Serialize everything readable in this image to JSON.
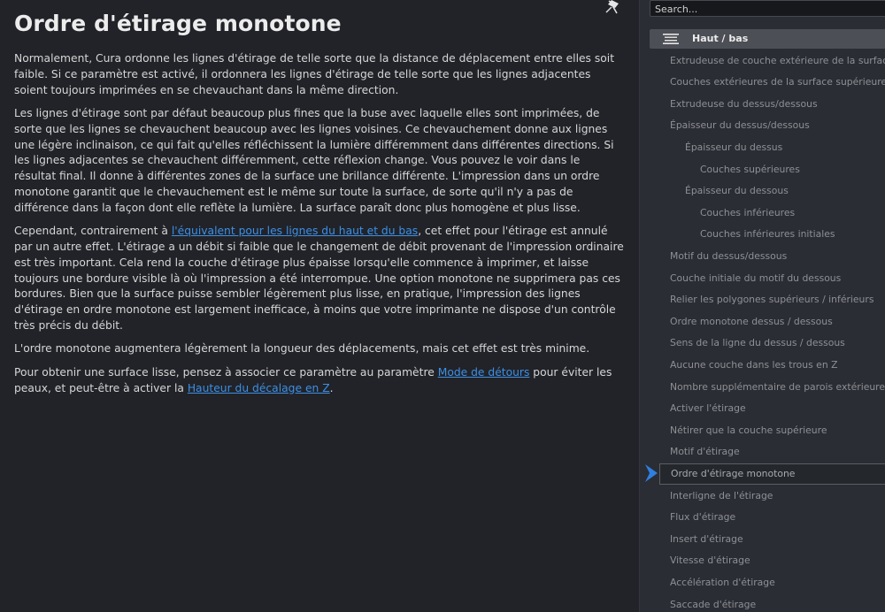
{
  "article": {
    "title": "Ordre d'étirage monotone",
    "p1": "Normalement, Cura ordonne les lignes d'étirage de telle sorte que la distance de déplacement entre elles soit faible. Si ce paramètre est activé, il ordonnera les lignes d'étirage de telle sorte que les lignes adjacentes soient toujours imprimées en se chevauchant dans la même direction.",
    "p2": "Les lignes d'étirage sont par défaut beaucoup plus fines que la buse avec laquelle elles sont imprimées, de sorte que les lignes se chevauchent beaucoup avec les lignes voisines. Ce chevauchement donne aux lignes une légère inclinaison, ce qui fait qu'elles réfléchissent la lumière différemment dans différentes directions. Si les lignes adjacentes se chevauchent différemment, cette réflexion change. Vous pouvez le voir dans le résultat final. Il donne à différentes zones de la surface une brillance différente. L'impression dans un ordre monotone garantit que le chevauchement est le même sur toute la surface, de sorte qu'il n'y a pas de différence dans la façon dont elle reflète la lumière. La surface paraît donc plus homogène et plus lisse.",
    "p3_before": "Cependant, contrairement à ",
    "p3_link": "l'équivalent pour les lignes du haut et du bas",
    "p3_after": ", cet effet pour l'étirage est annulé par un autre effet. L'étirage a un débit si faible que le changement de débit provenant de l'impression ordinaire est très important. Cela rend la couche d'étirage plus épaisse lorsqu'elle commence à imprimer, et laisse toujours une bordure visible là où l'impression a été interrompue. Une option monotone ne supprimera pas ces bordures. Bien que la surface puisse sembler légèrement plus lisse, en pratique, l'impression des lignes d'étirage en ordre monotone est largement inefficace, à moins que votre imprimante ne dispose d'un contrôle très précis du débit.",
    "p4": "L'ordre monotone augmentera légèrement la longueur des déplacements, mais cet effet est très minime.",
    "p5_before": "Pour obtenir une surface lisse, pensez à associer ce paramètre au paramètre ",
    "p5_link1": "Mode de détours",
    "p5_middle": " pour éviter les peaux, et peut-être à activer la ",
    "p5_link2": "Hauteur du décalage en Z",
    "p5_after": "."
  },
  "panel": {
    "search_value": "Search...",
    "category_label": "Haut / bas",
    "settings": [
      {
        "label": "Extrudeuse de couche extérieure de la surface supérieure",
        "level": 0
      },
      {
        "label": "Couches extérieures de la surface supérieure",
        "level": 0
      },
      {
        "label": "Extrudeuse du dessus/dessous",
        "level": 0
      },
      {
        "label": "Épaisseur du dessus/dessous",
        "level": 0
      },
      {
        "label": "Épaisseur du dessus",
        "level": 1
      },
      {
        "label": "Couches supérieures",
        "level": 2
      },
      {
        "label": "Épaisseur du dessous",
        "level": 1
      },
      {
        "label": "Couches inférieures",
        "level": 2
      },
      {
        "label": "Couches inférieures initiales",
        "level": 2
      },
      {
        "label": "Motif du dessus/dessous",
        "level": 0
      },
      {
        "label": "Couche initiale du motif du dessous",
        "level": 0
      },
      {
        "label": "Relier les polygones supérieurs / inférieurs",
        "level": 0
      },
      {
        "label": "Ordre monotone dessus / dessous",
        "level": 0
      },
      {
        "label": "Sens de la ligne du dessus / dessous",
        "level": 0
      },
      {
        "label": "Aucune couche dans les trous en Z",
        "level": 0
      },
      {
        "label": "Nombre supplémentaire de parois extérieures",
        "level": 0
      },
      {
        "label": "Activer l'étirage",
        "level": 0
      },
      {
        "label": "Nétirer que la couche supérieure",
        "level": 0
      },
      {
        "label": "Motif d'étirage",
        "level": 0
      },
      {
        "label": "Ordre d'étirage monotone",
        "level": 0,
        "selected": true
      },
      {
        "label": "Interligne de l'étirage",
        "level": 0
      },
      {
        "label": "Flux d'étirage",
        "level": 0
      },
      {
        "label": "Insert d'étirage",
        "level": 0
      },
      {
        "label": "Vitesse d'étirage",
        "level": 0
      },
      {
        "label": "Accélération d'étirage",
        "level": 0
      },
      {
        "label": "Saccade d'étirage",
        "level": 0
      }
    ]
  },
  "icons": {
    "pin": "pin-icon",
    "category": "layers-icon",
    "selection": "chevron-right-icon"
  },
  "colors": {
    "link": "#3d8fe6",
    "selection_chevron": "#2f7fe0",
    "background": "#212328",
    "panel": "#2a2d33"
  }
}
